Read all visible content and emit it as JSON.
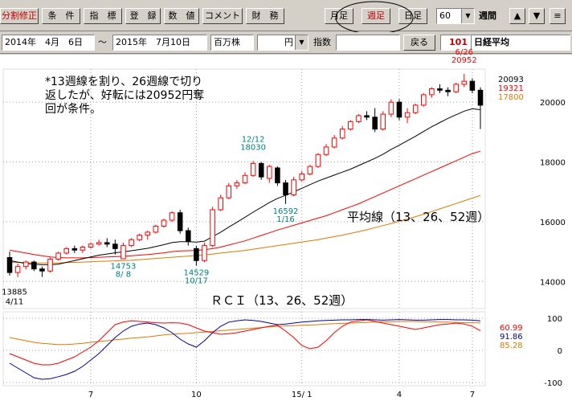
{
  "toolbar": {
    "buttons": [
      "分割修正",
      "条　件",
      "指　標",
      "登　録",
      "数　値",
      "コメント",
      "財　務"
    ],
    "period_buttons": [
      "月足",
      "週足",
      "日足"
    ],
    "count_value": "60",
    "unit_label": "週間",
    "nav_buttons": [
      "▲",
      "▼",
      "≡"
    ]
  },
  "datebar": {
    "from": "2014年　4月　6日",
    "tilde": "～",
    "to": "2015年　7月10日",
    "volume_unit": "百万株",
    "currency": "円",
    "indicator_label": "指数",
    "back_label": "戻る",
    "code": "101",
    "name": "日経平均"
  },
  "colors": {
    "bull": "#ff0000",
    "bear": "#000000",
    "ma13": "#000000",
    "ma26": "#ff0000",
    "ma52": "#e07800",
    "rci13": "#0000a0",
    "rci26": "#ff0000",
    "rci52": "#e07800",
    "label_teal": "#008080"
  },
  "chart_data": {
    "type": "candlestick",
    "note": "*13週線を割り、26週線で切り\n返したが、好転には20952円奪\n回が条件。",
    "ma_label": "平均線（13、26、52週）",
    "rci_label": "ＲＣＩ（13、26、52週）",
    "ohlc": [
      [
        14800,
        15000,
        14200,
        14300
      ],
      [
        14300,
        14600,
        14150,
        14500
      ],
      [
        14500,
        14700,
        14400,
        14650
      ],
      [
        14650,
        14700,
        14350,
        14420
      ],
      [
        14420,
        14500,
        14150,
        14350
      ],
      [
        14350,
        14800,
        14300,
        14750
      ],
      [
        14750,
        15000,
        14700,
        14950
      ],
      [
        14950,
        15150,
        14900,
        15100
      ],
      [
        15100,
        15200,
        14950,
        15050
      ],
      [
        15050,
        15200,
        14950,
        15150
      ],
      [
        15150,
        15300,
        15100,
        15250
      ],
      [
        15250,
        15400,
        15200,
        15300
      ],
      [
        15300,
        15450,
        15150,
        15250
      ],
      [
        15250,
        15400,
        14900,
        15100
      ],
      [
        14760,
        15300,
        14753,
        15200
      ],
      [
        15200,
        15450,
        15150,
        15400
      ],
      [
        15400,
        15600,
        15350,
        15550
      ],
      [
        15550,
        15700,
        15400,
        15650
      ],
      [
        15650,
        15900,
        15600,
        15850
      ],
      [
        15850,
        16100,
        15800,
        16050
      ],
      [
        16050,
        16350,
        16000,
        16300
      ],
      [
        16300,
        16400,
        15600,
        15700
      ],
      [
        15700,
        15800,
        15200,
        15350
      ],
      [
        15100,
        15200,
        14529,
        14700
      ],
      [
        14700,
        15300,
        14650,
        15200
      ],
      [
        15200,
        16500,
        15150,
        16400
      ],
      [
        16400,
        16900,
        16350,
        16800
      ],
      [
        16800,
        17300,
        16750,
        17200
      ],
      [
        17200,
        17400,
        17100,
        17300
      ],
      [
        17300,
        17650,
        17250,
        17550
      ],
      [
        17550,
        18030,
        17500,
        17950
      ],
      [
        17950,
        18000,
        17400,
        17500
      ],
      [
        17450,
        17900,
        17300,
        17850
      ],
      [
        17800,
        17850,
        17200,
        17300
      ],
      [
        17300,
        17400,
        16592,
        16900
      ],
      [
        16900,
        17500,
        16850,
        17400
      ],
      [
        17400,
        17700,
        17350,
        17600
      ],
      [
        17600,
        17900,
        17550,
        17850
      ],
      [
        17850,
        18300,
        17800,
        18250
      ],
      [
        18250,
        18600,
        18200,
        18500
      ],
      [
        18500,
        18900,
        18450,
        18800
      ],
      [
        18800,
        19200,
        18750,
        19100
      ],
      [
        19100,
        19400,
        19050,
        19350
      ],
      [
        19350,
        19600,
        19300,
        19550
      ],
      [
        19550,
        19700,
        19400,
        19500
      ],
      [
        19500,
        19800,
        19000,
        19100
      ],
      [
        19100,
        19700,
        19050,
        19600
      ],
      [
        19600,
        20100,
        19500,
        20000
      ],
      [
        20000,
        20100,
        19400,
        19500
      ],
      [
        19500,
        19800,
        19300,
        19650
      ],
      [
        19650,
        19950,
        19600,
        19900
      ],
      [
        19900,
        20300,
        19850,
        20250
      ],
      [
        20250,
        20500,
        20150,
        20450
      ],
      [
        20450,
        20600,
        20300,
        20400
      ],
      [
        20400,
        20500,
        20200,
        20350
      ],
      [
        20350,
        20650,
        20300,
        20600
      ],
      [
        20600,
        20952,
        20500,
        20700
      ],
      [
        20700,
        20800,
        20300,
        20400
      ],
      [
        20400,
        20500,
        19100,
        19900
      ]
    ],
    "ma13": [
      14700,
      14650,
      14600,
      14580,
      14560,
      14560,
      14580,
      14640,
      14700,
      14760,
      14820,
      14880,
      14920,
      14960,
      14990,
      15030,
      15070,
      15110,
      15170,
      15230,
      15300,
      15330,
      15330,
      15320,
      15350,
      15500,
      15650,
      15820,
      15980,
      16150,
      16320,
      16480,
      16640,
      16780,
      16880,
      17000,
      17120,
      17240,
      17360,
      17460,
      17560,
      17660,
      17760,
      17880,
      18000,
      18120,
      18260,
      18420,
      18560,
      18710,
      18860,
      19020,
      19180,
      19320,
      19460,
      19580,
      19700,
      19780,
      19750
    ],
    "ma26": [
      15050,
      15000,
      14950,
      14900,
      14860,
      14820,
      14800,
      14790,
      14790,
      14790,
      14800,
      14810,
      14820,
      14830,
      14840,
      14860,
      14880,
      14900,
      14930,
      14960,
      15000,
      15020,
      15030,
      15040,
      15060,
      15100,
      15150,
      15220,
      15290,
      15360,
      15450,
      15540,
      15630,
      15720,
      15800,
      15880,
      15960,
      16040,
      16120,
      16200,
      16300,
      16400,
      16500,
      16600,
      16720,
      16840,
      16960,
      17080,
      17200,
      17320,
      17440,
      17560,
      17680,
      17800,
      17920,
      18040,
      18160,
      18280,
      18360
    ],
    "ma52": [
      14650,
      14640,
      14630,
      14620,
      14620,
      14620,
      14620,
      14630,
      14640,
      14650,
      14660,
      14670,
      14680,
      14690,
      14700,
      14710,
      14730,
      14750,
      14770,
      14790,
      14810,
      14830,
      14850,
      14870,
      14890,
      14920,
      14950,
      14980,
      15010,
      15040,
      15080,
      15120,
      15160,
      15200,
      15240,
      15280,
      15320,
      15360,
      15400,
      15450,
      15500,
      15550,
      15610,
      15670,
      15730,
      15800,
      15870,
      15940,
      16010,
      16090,
      16170,
      16250,
      16340,
      16430,
      16520,
      16610,
      16700,
      16790,
      16880
    ],
    "rci13": [
      -40,
      -55,
      -70,
      -85,
      -90,
      -88,
      -82,
      -75,
      -65,
      -50,
      -30,
      -10,
      15,
      40,
      60,
      75,
      82,
      85,
      80,
      70,
      55,
      35,
      20,
      10,
      30,
      55,
      75,
      88,
      92,
      95,
      93,
      90,
      85,
      80,
      82,
      85,
      88,
      90,
      92,
      93,
      94,
      95,
      95,
      96,
      96,
      95,
      94,
      95,
      96,
      95,
      94,
      94,
      95,
      96,
      96,
      95,
      95,
      94,
      91.86
    ],
    "rci26": [
      -10,
      -20,
      -30,
      -40,
      -45,
      -45,
      -40,
      -30,
      -20,
      -5,
      10,
      30,
      55,
      80,
      88,
      92,
      90,
      88,
      86,
      85,
      86,
      85,
      80,
      70,
      60,
      55,
      50,
      52,
      55,
      60,
      65,
      70,
      75,
      78,
      60,
      40,
      15,
      5,
      10,
      30,
      55,
      75,
      88,
      92,
      95,
      90,
      85,
      80,
      75,
      70,
      65,
      70,
      75,
      80,
      82,
      85,
      82,
      75,
      60.99
    ],
    "rci52": [
      40,
      35,
      30,
      25,
      22,
      20,
      18,
      18,
      20,
      22,
      25,
      28,
      30,
      33,
      35,
      38,
      40,
      42,
      45,
      48,
      50,
      52,
      53,
      55,
      57,
      59,
      61,
      63,
      65,
      67,
      69,
      71,
      73,
      75,
      76,
      77,
      78,
      79,
      80,
      82,
      83,
      84,
      85,
      86,
      87,
      88,
      89,
      89,
      90,
      90,
      90,
      89,
      89,
      88,
      88,
      87,
      86,
      86,
      85.28
    ],
    "x_tick_labels": [
      "7",
      "10",
      "15/ 1",
      "4",
      "7"
    ],
    "y_tick_labels": [
      "20000",
      "18000",
      "16000",
      "14000"
    ],
    "ylim": [
      13200,
      21000
    ],
    "rci_tick_labels": [
      "100",
      "0",
      "-100"
    ],
    "rci_ylim": [
      -100,
      100
    ],
    "right_values": [
      "20093",
      "19321",
      "17800"
    ],
    "rci_right_values": [
      "60.99",
      "91.86",
      "85.28"
    ],
    "annotations": [
      {
        "lines": [
          "6/26",
          "20952"
        ],
        "index": 56,
        "value": 20952,
        "pos": "above",
        "color": "red"
      },
      {
        "lines": [
          "12/12",
          "18030"
        ],
        "index": 30,
        "value": 18030,
        "pos": "above",
        "color": "teal"
      },
      {
        "lines": [
          "16592",
          "1/16"
        ],
        "index": 34,
        "value": 16592,
        "pos": "below",
        "color": "teal"
      },
      {
        "lines": [
          "14753",
          "8/ 8"
        ],
        "index": 14,
        "value": 14753,
        "pos": "below",
        "color": "teal"
      },
      {
        "lines": [
          "14529",
          "10/17"
        ],
        "index": 23,
        "value": 14529,
        "pos": "below",
        "color": "teal"
      },
      {
        "lines": [
          "13885",
          "4/11"
        ],
        "index": 0,
        "value": 13885,
        "pos": "left-below",
        "color": "black"
      }
    ]
  }
}
